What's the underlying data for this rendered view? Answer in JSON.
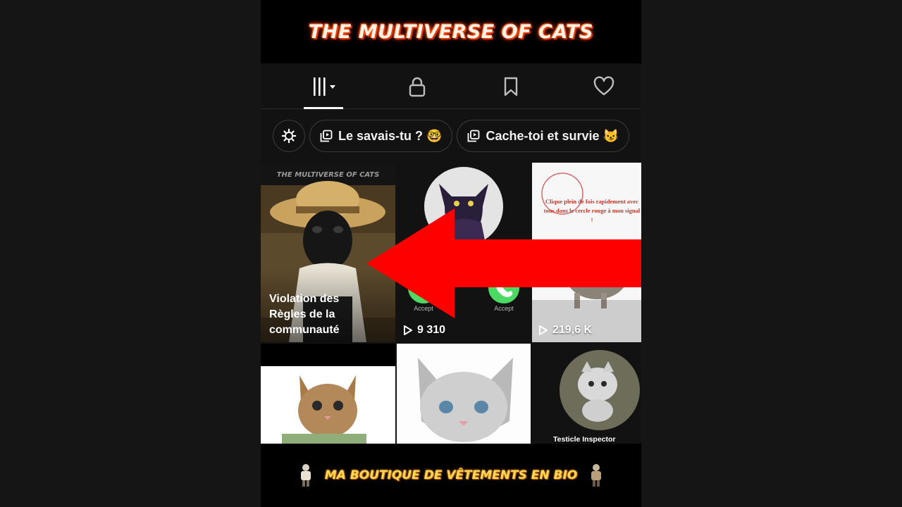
{
  "banner_top": {
    "title": "THE MULTIVERSE OF CATS"
  },
  "tabs": [
    {
      "icon": "grid-icon",
      "selected": true
    },
    {
      "icon": "lock-icon",
      "selected": false
    },
    {
      "icon": "bookmark-icon",
      "selected": false
    },
    {
      "icon": "heart-icon",
      "selected": false
    }
  ],
  "chips": [
    {
      "icon": "settings-icon",
      "label": ""
    },
    {
      "icon": "playlist-icon",
      "label": "Le savais-tu ? 🤓"
    },
    {
      "icon": "playlist-icon",
      "label": "Cache-toi et survie 😼"
    }
  ],
  "grid": {
    "cell1": {
      "thumb_title": "THE MULTIVERSE OF CATS",
      "overlay": "Violation des Règles de la communauté"
    },
    "cell2": {
      "accept1": "Accept",
      "accept2": "Accept",
      "views": "9 310"
    },
    "cell3": {
      "caption": "Clique plein de fois rapidement avec tous dans le cercle rouge à mon signal !",
      "views": "219,6 K"
    },
    "cell6": {
      "caption": "Testicle Inspector"
    }
  },
  "banner_bottom": {
    "text": "MA BOUTIQUE DE VÊTEMENTS EN BIO"
  },
  "colors": {
    "accent_red": "#ff0000",
    "title_glow": "#ff3b00",
    "bottom_text": "#ffd85a",
    "accept_green": "#4cd964"
  }
}
